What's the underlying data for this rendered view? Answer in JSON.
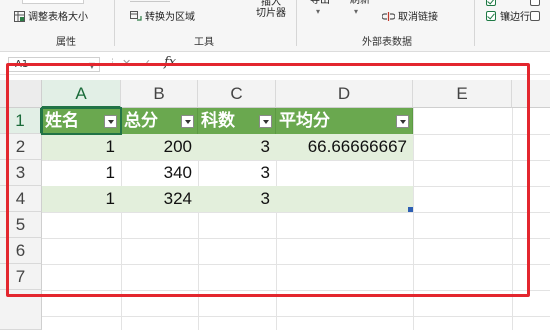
{
  "ribbon": {
    "properties": {
      "resize_table": "调整表格大小",
      "group": "属性"
    },
    "tools": {
      "convert_range": "转换为区域",
      "insert_slicer_l1": "插入",
      "insert_slicer_l2": "切片器",
      "group": "工具"
    },
    "external": {
      "export": "导出",
      "refresh": "刷新",
      "unlink": "取消链接",
      "group": "外部表数据"
    },
    "style_options": {
      "banded_rows": "镶边行",
      "banded_rows_checked": true,
      "second_checked": false
    }
  },
  "formula_bar": {
    "name_box": "A1",
    "fx": "fx",
    "formula": ""
  },
  "grid": {
    "columns": [
      "A",
      "B",
      "C",
      "D",
      "E"
    ],
    "rows": [
      "1",
      "2",
      "3",
      "4",
      "5",
      "6",
      "7"
    ],
    "active_column": "A",
    "active_row": "1"
  },
  "table": {
    "headers": [
      "姓名",
      "总分",
      "科数",
      "平均分"
    ],
    "rows": [
      [
        "1",
        "200",
        "3",
        "66.66666667"
      ],
      [
        "1",
        "340",
        "3",
        ""
      ],
      [
        "1",
        "324",
        "3",
        ""
      ]
    ]
  },
  "colors": {
    "header_green": "#6aa84f",
    "band_green": "#e3efdc",
    "annotation_red": "#e3262e",
    "excel_green": "#217346"
  }
}
